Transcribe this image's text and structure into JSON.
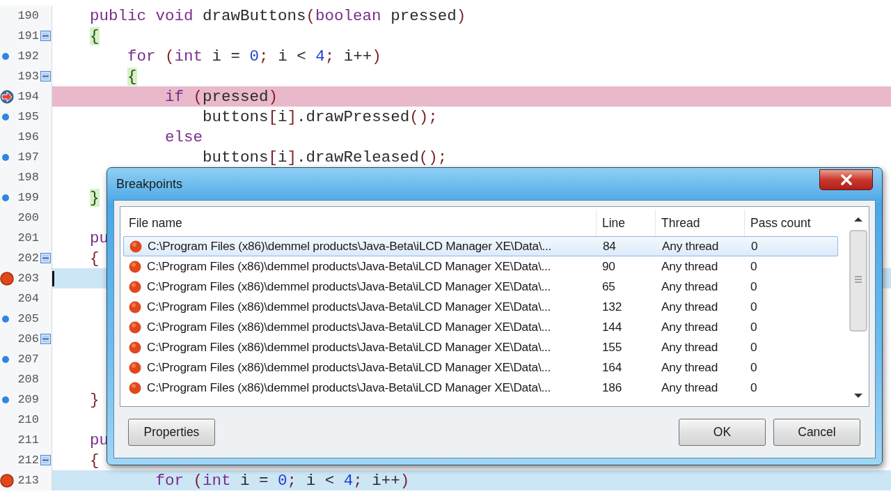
{
  "editor": {
    "lines": [
      {
        "number": "190",
        "bookmark": false,
        "breakpoint": false,
        "current": false,
        "foldable": false,
        "cursor": false,
        "code": [
          {
            "kind": "keyword",
            "text": "    public void "
          },
          {
            "kind": "ident",
            "text": "drawButtons"
          },
          {
            "kind": "punct",
            "text": "("
          },
          {
            "kind": "keyword",
            "text": "boolean "
          },
          {
            "kind": "ident",
            "text": "pressed"
          },
          {
            "kind": "punct",
            "text": ")"
          }
        ]
      },
      {
        "number": "191",
        "bookmark": false,
        "breakpoint": false,
        "current": false,
        "foldable": true,
        "cursor": false,
        "code": [
          {
            "kind": "brace-match",
            "text": "    {"
          }
        ]
      },
      {
        "number": "192",
        "bookmark": true,
        "breakpoint": false,
        "current": false,
        "foldable": false,
        "cursor": false,
        "code": [
          {
            "kind": "keyword",
            "text": "        for "
          },
          {
            "kind": "punct",
            "text": "("
          },
          {
            "kind": "keyword",
            "text": "int "
          },
          {
            "kind": "ident",
            "text": "i = "
          },
          {
            "kind": "number",
            "text": "0"
          },
          {
            "kind": "punct",
            "text": "; "
          },
          {
            "kind": "ident",
            "text": "i < "
          },
          {
            "kind": "number",
            "text": "4"
          },
          {
            "kind": "punct",
            "text": "; "
          },
          {
            "kind": "ident",
            "text": "i++"
          },
          {
            "kind": "punct",
            "text": ")"
          }
        ]
      },
      {
        "number": "193",
        "bookmark": false,
        "breakpoint": false,
        "current": false,
        "foldable": true,
        "cursor": false,
        "code": [
          {
            "kind": "brace-match",
            "text": "        {"
          }
        ]
      },
      {
        "number": "194",
        "bookmark": false,
        "breakpoint": false,
        "current": true,
        "foldable": false,
        "cursor": false,
        "code": [
          {
            "kind": "keyword",
            "text": "            if "
          },
          {
            "kind": "punct",
            "text": "("
          },
          {
            "kind": "ident",
            "text": "pressed"
          },
          {
            "kind": "punct",
            "text": ")"
          }
        ]
      },
      {
        "number": "195",
        "bookmark": true,
        "breakpoint": false,
        "current": false,
        "foldable": false,
        "cursor": false,
        "code": [
          {
            "kind": "ident",
            "text": "                buttons"
          },
          {
            "kind": "punct",
            "text": "["
          },
          {
            "kind": "ident",
            "text": "i"
          },
          {
            "kind": "punct",
            "text": "]"
          },
          {
            "kind": "ident",
            "text": ".drawPressed"
          },
          {
            "kind": "punct",
            "text": "();"
          }
        ]
      },
      {
        "number": "196",
        "bookmark": false,
        "breakpoint": false,
        "current": false,
        "foldable": false,
        "cursor": false,
        "code": [
          {
            "kind": "keyword",
            "text": "            else"
          }
        ]
      },
      {
        "number": "197",
        "bookmark": true,
        "breakpoint": false,
        "current": false,
        "foldable": false,
        "cursor": false,
        "code": [
          {
            "kind": "ident",
            "text": "                buttons"
          },
          {
            "kind": "punct",
            "text": "["
          },
          {
            "kind": "ident",
            "text": "i"
          },
          {
            "kind": "punct",
            "text": "]"
          },
          {
            "kind": "ident",
            "text": ".drawReleased"
          },
          {
            "kind": "punct",
            "text": "();"
          }
        ]
      },
      {
        "number": "198",
        "bookmark": false,
        "breakpoint": false,
        "current": false,
        "foldable": false,
        "cursor": false
      },
      {
        "number": "199",
        "bookmark": true,
        "breakpoint": false,
        "current": false,
        "foldable": false,
        "cursor": false,
        "code": [
          {
            "kind": "brace-match",
            "text": "    }"
          }
        ]
      },
      {
        "number": "200",
        "bookmark": false,
        "breakpoint": false,
        "current": false,
        "foldable": false,
        "cursor": false
      },
      {
        "number": "201",
        "bookmark": false,
        "breakpoint": false,
        "current": false,
        "foldable": false,
        "cursor": false,
        "code": [
          {
            "kind": "keyword",
            "text": "    pu"
          }
        ]
      },
      {
        "number": "202",
        "bookmark": false,
        "breakpoint": false,
        "current": false,
        "foldable": true,
        "cursor": false,
        "code": [
          {
            "kind": "punct",
            "text": "    {"
          }
        ]
      },
      {
        "number": "203",
        "bookmark": false,
        "breakpoint": true,
        "current": false,
        "foldable": false,
        "cursor": true
      },
      {
        "number": "204",
        "bookmark": false,
        "breakpoint": false,
        "current": false,
        "foldable": false,
        "cursor": false
      },
      {
        "number": "205",
        "bookmark": true,
        "breakpoint": false,
        "current": false,
        "foldable": false,
        "cursor": false
      },
      {
        "number": "206",
        "bookmark": false,
        "breakpoint": false,
        "current": false,
        "foldable": true,
        "cursor": false
      },
      {
        "number": "207",
        "bookmark": true,
        "breakpoint": false,
        "current": false,
        "foldable": false,
        "cursor": false
      },
      {
        "number": "208",
        "bookmark": false,
        "breakpoint": false,
        "current": false,
        "foldable": false,
        "cursor": false
      },
      {
        "number": "209",
        "bookmark": true,
        "breakpoint": false,
        "current": false,
        "foldable": false,
        "cursor": false,
        "code": [
          {
            "kind": "punct",
            "text": "    }"
          }
        ]
      },
      {
        "number": "210",
        "bookmark": false,
        "breakpoint": false,
        "current": false,
        "foldable": false,
        "cursor": false
      },
      {
        "number": "211",
        "bookmark": false,
        "breakpoint": false,
        "current": false,
        "foldable": false,
        "cursor": false,
        "code": [
          {
            "kind": "keyword",
            "text": "    pu"
          }
        ]
      },
      {
        "number": "212",
        "bookmark": false,
        "breakpoint": false,
        "current": false,
        "foldable": true,
        "cursor": false,
        "code": [
          {
            "kind": "punct",
            "text": "    {"
          }
        ]
      },
      {
        "number": "213",
        "bookmark": false,
        "breakpoint": true,
        "current": false,
        "foldable": false,
        "cursor": false,
        "code": [
          {
            "kind": "keyword",
            "text": "           for "
          },
          {
            "kind": "punct",
            "text": "("
          },
          {
            "kind": "keyword",
            "text": "int "
          },
          {
            "kind": "ident",
            "text": "i = "
          },
          {
            "kind": "number",
            "text": "0"
          },
          {
            "kind": "punct",
            "text": "; "
          },
          {
            "kind": "ident",
            "text": "i < "
          },
          {
            "kind": "number",
            "text": "4"
          },
          {
            "kind": "punct",
            "text": "; "
          },
          {
            "kind": "ident",
            "text": "i++"
          },
          {
            "kind": "punct",
            "text": ")"
          }
        ]
      }
    ]
  },
  "dialog": {
    "title": "Breakpoints",
    "columns": [
      "File name",
      "Line",
      "Thread",
      "Pass count"
    ],
    "rows": [
      {
        "file": "C:\\Program Files (x86)\\demmel products\\Java-Beta\\iLCD Manager XE\\Data\\...",
        "line": "84",
        "thread": "Any thread",
        "pass_count": "0",
        "selected": true
      },
      {
        "file": "C:\\Program Files (x86)\\demmel products\\Java-Beta\\iLCD Manager XE\\Data\\...",
        "line": "90",
        "thread": "Any thread",
        "pass_count": "0",
        "selected": false
      },
      {
        "file": "C:\\Program Files (x86)\\demmel products\\Java-Beta\\iLCD Manager XE\\Data\\...",
        "line": "65",
        "thread": "Any thread",
        "pass_count": "0",
        "selected": false
      },
      {
        "file": "C:\\Program Files (x86)\\demmel products\\Java-Beta\\iLCD Manager XE\\Data\\...",
        "line": "132",
        "thread": "Any thread",
        "pass_count": "0",
        "selected": false
      },
      {
        "file": "C:\\Program Files (x86)\\demmel products\\Java-Beta\\iLCD Manager XE\\Data\\...",
        "line": "144",
        "thread": "Any thread",
        "pass_count": "0",
        "selected": false
      },
      {
        "file": "C:\\Program Files (x86)\\demmel products\\Java-Beta\\iLCD Manager XE\\Data\\...",
        "line": "155",
        "thread": "Any thread",
        "pass_count": "0",
        "selected": false
      },
      {
        "file": "C:\\Program Files (x86)\\demmel products\\Java-Beta\\iLCD Manager XE\\Data\\...",
        "line": "164",
        "thread": "Any thread",
        "pass_count": "0",
        "selected": false
      },
      {
        "file": "C:\\Program Files (x86)\\demmel products\\Java-Beta\\iLCD Manager XE\\Data\\...",
        "line": "186",
        "thread": "Any thread",
        "pass_count": "0",
        "selected": false
      }
    ],
    "buttons": [
      {
        "kind": "left",
        "label": "Properties"
      },
      {
        "kind": "right",
        "label": "OK"
      },
      {
        "kind": "right",
        "label": "Cancel"
      }
    ]
  }
}
